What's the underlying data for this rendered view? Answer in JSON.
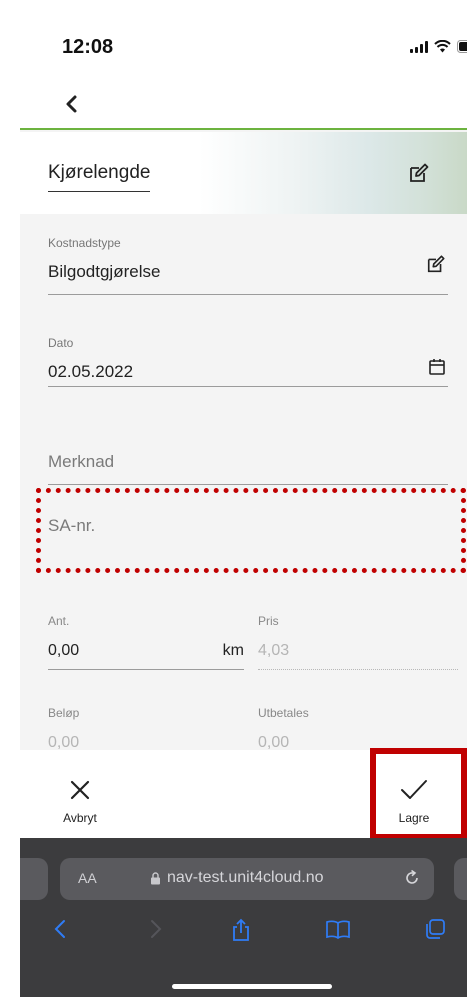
{
  "status": {
    "time": "12:08"
  },
  "header": {
    "title": "Kjørelengde"
  },
  "form": {
    "kostnadstype": {
      "label": "Kostnadstype",
      "value": "Bilgodtgjørelse"
    },
    "dato": {
      "label": "Dato",
      "value": "02.05.2022"
    },
    "merknad": {
      "placeholder": "Merknad"
    },
    "sa_nr": {
      "placeholder": "SA-nr."
    },
    "ant": {
      "label": "Ant.",
      "value": "0,00",
      "unit": "km"
    },
    "pris": {
      "label": "Pris",
      "value": "4,03"
    },
    "belop": {
      "label": "Beløp",
      "value": "0,00"
    },
    "utbetales": {
      "label": "Utbetales",
      "value": "0,00"
    }
  },
  "actions": {
    "cancel_label": "Avbryt",
    "save_label": "Lagre"
  },
  "browser": {
    "aa_label": "AA",
    "url": "nav-test.unit4cloud.no"
  },
  "colors": {
    "accent_green": "#6cb33f",
    "highlight_red": "#c00000",
    "safari_blue": "#2f7cf6"
  },
  "icons": [
    "back-chevron-icon",
    "edit-icon",
    "calendar-icon",
    "close-icon",
    "checkmark-icon",
    "lock-icon",
    "reload-icon",
    "share-icon",
    "bookmarks-icon",
    "tabs-icon"
  ]
}
